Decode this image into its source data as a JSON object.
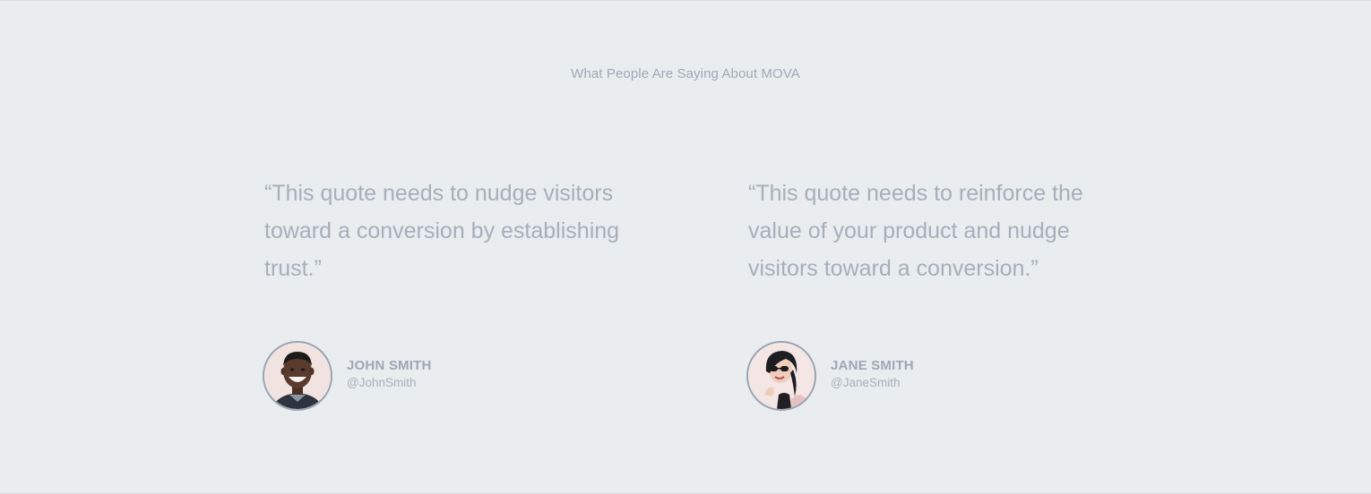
{
  "section": {
    "heading": "What People Are Saying About MOVA"
  },
  "testimonials": [
    {
      "quote": "“This quote needs to nudge visitors toward a conversion by establishing trust.”",
      "name": "JOHN SMITH",
      "handle": "@JohnSmith",
      "avatar_icon": "avatar-photo-man"
    },
    {
      "quote": "“This quote needs to reinforce the value of your product and nudge visitors toward a conversion.”",
      "name": "JANE SMITH",
      "handle": "@JaneSmith",
      "avatar_icon": "avatar-photo-woman"
    }
  ],
  "colors": {
    "background": "#e9edf0",
    "text": "#a6afbb",
    "avatar_border": "#9aa3b0"
  }
}
